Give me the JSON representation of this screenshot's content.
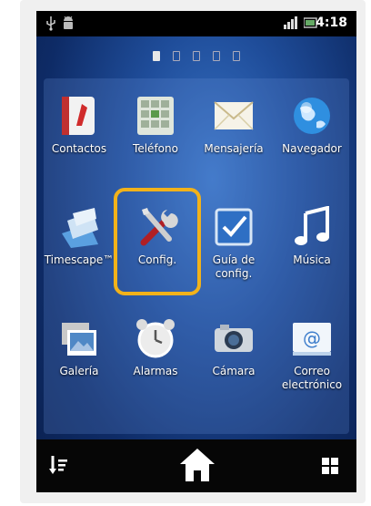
{
  "status_bar": {
    "time": "4:18",
    "icons": [
      "usb-icon",
      "android-icon",
      "signal-icon",
      "battery-icon"
    ]
  },
  "pager": {
    "pages": 5,
    "active_index": 0
  },
  "apps": [
    {
      "label": "Contactos",
      "icon": "contacts-icon"
    },
    {
      "label": "Teléfono",
      "icon": "phone-keypad-icon"
    },
    {
      "label": "Mensajería",
      "icon": "envelope-icon"
    },
    {
      "label": "Navegador",
      "icon": "globe-icon"
    },
    {
      "label": "Timescape™",
      "icon": "timescape-icon"
    },
    {
      "label": "Config.",
      "icon": "settings-tools-icon"
    },
    {
      "label": "Guía de config.",
      "icon": "checkbox-icon"
    },
    {
      "label": "Música",
      "icon": "music-note-icon"
    },
    {
      "label": "Galería",
      "icon": "gallery-icon"
    },
    {
      "label": "Alarmas",
      "icon": "alarm-clock-icon"
    },
    {
      "label": "Cámara",
      "icon": "camera-icon"
    },
    {
      "label": "Correo electrónico",
      "icon": "email-icon"
    }
  ],
  "bottom_bar": {
    "left": "sort-icon",
    "center": "home-icon",
    "right": "app-grid-icon"
  },
  "colors": {
    "highlight": "#f2b21a",
    "wallpaper": "#1f4d9a"
  }
}
